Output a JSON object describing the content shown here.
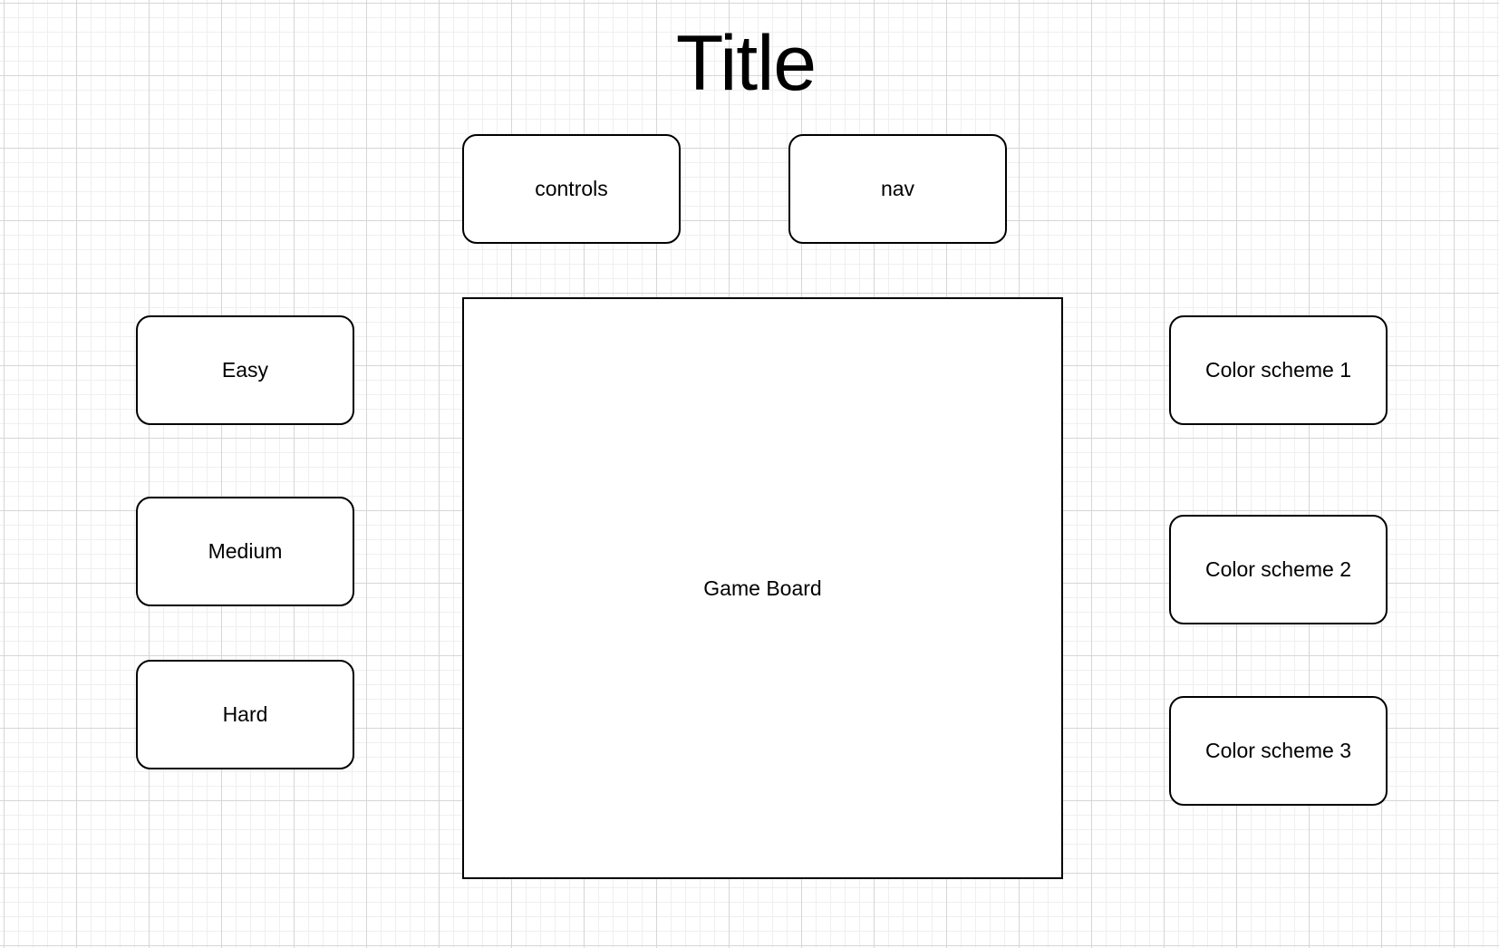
{
  "title": "Title",
  "top_buttons": {
    "controls": "controls",
    "nav": "nav"
  },
  "difficulty": [
    "Easy",
    "Medium",
    "Hard"
  ],
  "color_schemes": [
    "Color scheme 1",
    "Color scheme 2",
    "Color scheme 3"
  ],
  "board": {
    "label": "Game Board"
  },
  "colors": {
    "background": "#ffffff",
    "grid_major": "#d6d6d6",
    "grid_minor": "#efefef",
    "stroke": "#000000"
  }
}
